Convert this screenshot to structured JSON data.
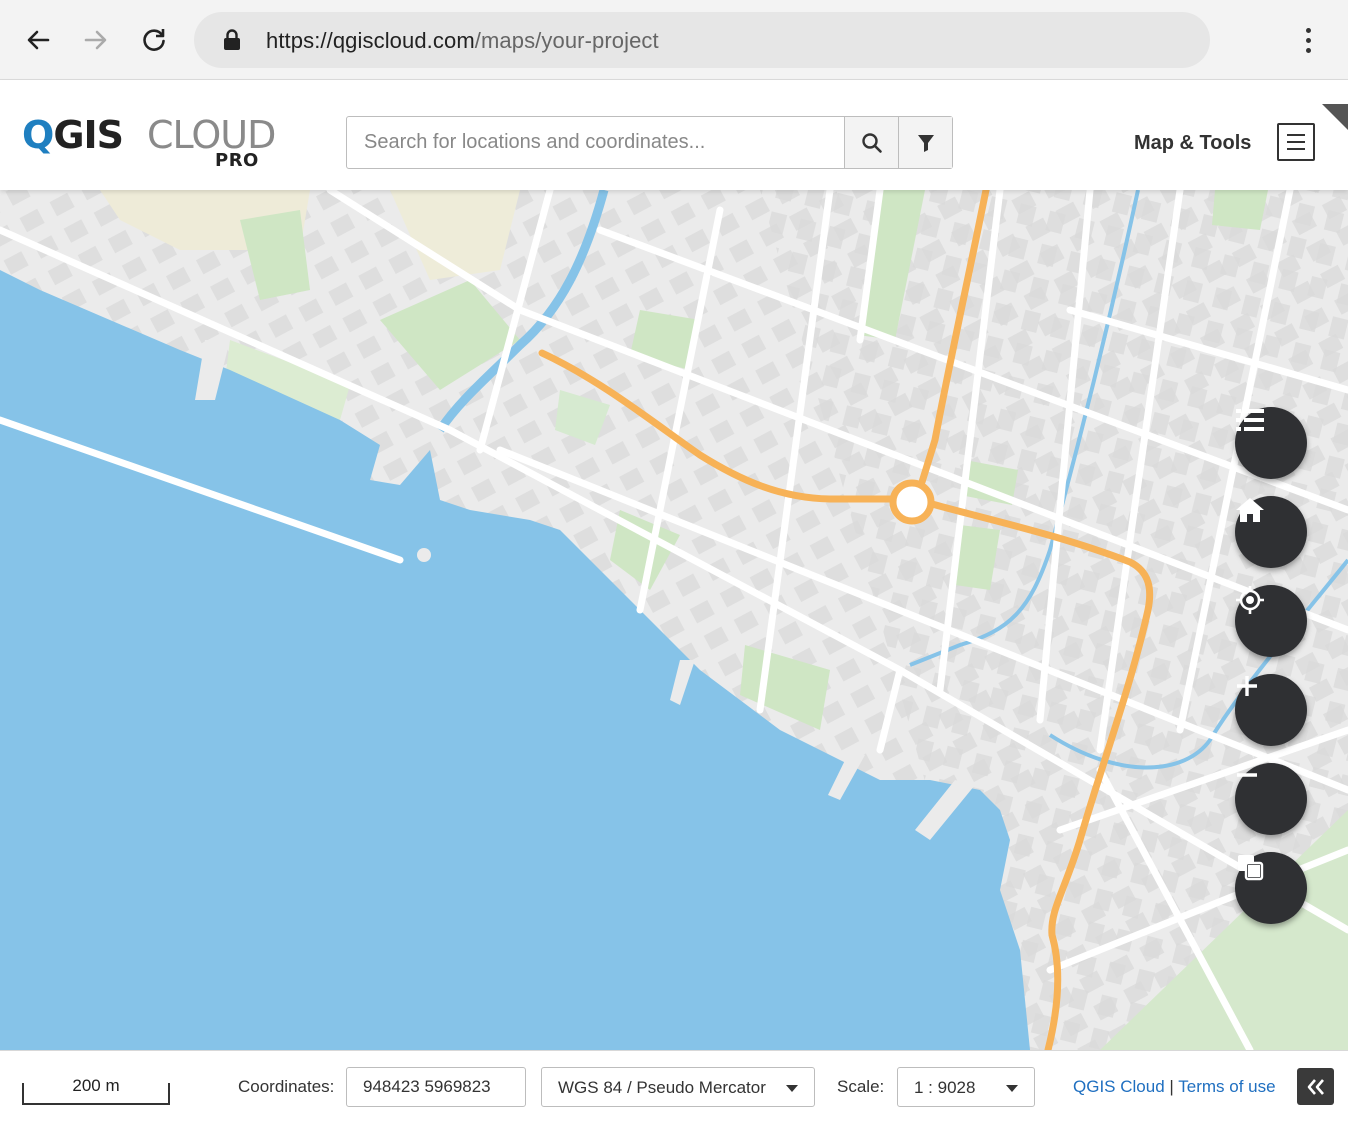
{
  "browser": {
    "url_main": "https://qgiscloud.com",
    "url_path": "/maps/your-project"
  },
  "header": {
    "logo_q": "Q",
    "logo_gis": "GIS",
    "logo_cloud": "CLOUD",
    "logo_pro": "PRO",
    "search_placeholder": "Search for locations and coordinates...",
    "tools_label": "Map & Tools"
  },
  "map_controls": [
    "layer-list",
    "home",
    "locate",
    "zoom-in",
    "zoom-out",
    "basemap-switch"
  ],
  "footer": {
    "scalebar_label": "200 m",
    "coordinates_label": "Coordinates:",
    "coordinates_value": "948423 5969823",
    "crs_value": "WGS 84 / Pseudo Mercator",
    "scale_label": "Scale:",
    "scale_value": "1 : 9028",
    "link_qgis": "QGIS Cloud",
    "link_separator": "|",
    "link_terms": "Terms of use"
  },
  "colors": {
    "water": "#86c3e8",
    "road_highlight": "#f7b257",
    "park": "#cfe6c4",
    "button_dark": "#2f3033",
    "brand_blue": "#1f7fc0"
  }
}
